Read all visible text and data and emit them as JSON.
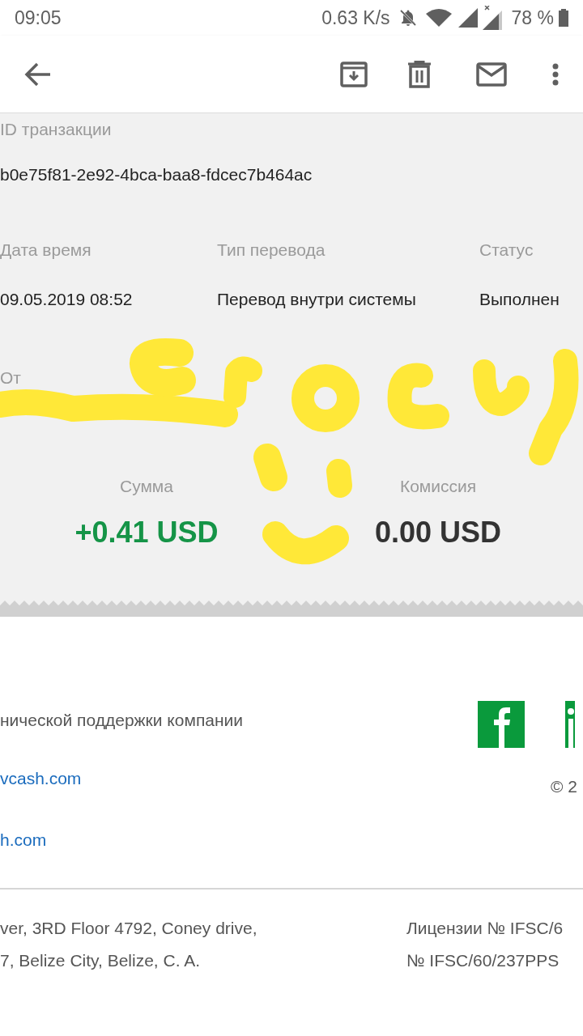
{
  "status_bar": {
    "time": "09:05",
    "speed": "0.63 K/s",
    "battery": "78 %"
  },
  "receipt": {
    "id_label": "ID транзакции",
    "id_value": "b0e75f81-2e92-4bca-baa8-fdcec7b464ac",
    "columns": [
      {
        "label": "Дата время",
        "value": "09.05.2019 08:52"
      },
      {
        "label": "Тип перевода",
        "value": "Перевод внутри системы"
      },
      {
        "label": "Статус",
        "value": "Выполнен"
      }
    ],
    "from_label": "От",
    "amounts": [
      {
        "label": "Сумма",
        "value": "+0.41 USD",
        "kind": "credit"
      },
      {
        "label": "Комиссия",
        "value": "0.00 USD",
        "kind": "neutral"
      }
    ]
  },
  "footer": {
    "support_text": "нической поддержки компании",
    "links": [
      "vcash.com",
      "h.com"
    ],
    "copyright": "© 2",
    "address": [
      "ver, 3RD Floor 4792, Coney drive,",
      "7, Belize City, Belize, C. A."
    ],
    "license": [
      "Лицензии № IFSC/6",
      "№ IFSC/60/237PPS"
    ]
  }
}
